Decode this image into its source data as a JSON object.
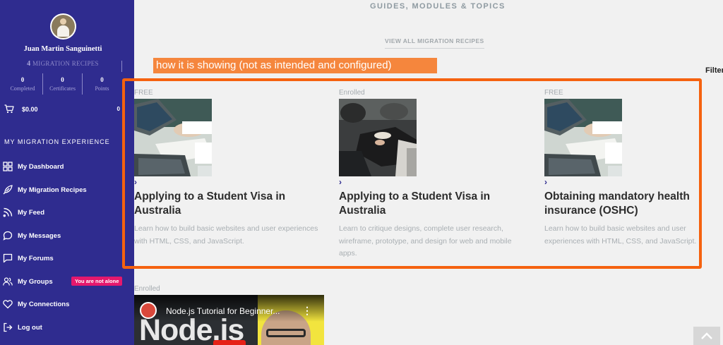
{
  "sidebar": {
    "user_name": "Juan Martin Sanguinetti",
    "recipes_count": "4",
    "recipes_label": "MIGRATION RECIPES",
    "stats": [
      {
        "value": "0",
        "label": "Completed"
      },
      {
        "value": "0",
        "label": "Certificates"
      },
      {
        "value": "0",
        "label": "Points"
      }
    ],
    "cart_amount": "$0.00",
    "cart_count": "0",
    "section_heading": "MY MIGRATION EXPERIENCE",
    "nav": [
      {
        "label": "My Dashboard",
        "icon": "grid-icon"
      },
      {
        "label": "My Migration Recipes",
        "icon": "rocket-icon"
      },
      {
        "label": "My Feed",
        "icon": "rss-icon"
      },
      {
        "label": "My Messages",
        "icon": "chat-bubble-icon"
      },
      {
        "label": "My Forums",
        "icon": "forum-icon"
      },
      {
        "label": "My Groups",
        "icon": "users-icon",
        "badge": "You are not alone"
      },
      {
        "label": "My Connections",
        "icon": "heart-icon"
      },
      {
        "label": "Log out",
        "icon": "logout-icon"
      }
    ]
  },
  "main": {
    "section_title": "GUIDES, MODULES & TOPICS",
    "view_all_link": "VIEW ALL MIGRATION RECIPES",
    "annotation_label": "how it is showing (not as intended and configured)",
    "filter_label": "Filter",
    "cards": [
      {
        "tag": "FREE",
        "title": "Applying to a Student Visa in Australia",
        "description": "Learn how to build basic websites and user experiences with HTML, CSS, and JavaScript."
      },
      {
        "tag": "Enrolled",
        "title": "Applying to a Student Visa in Australia",
        "description": "Learn to critique designs, complete user research, wireframe, prototype, and design for web and mobile apps."
      },
      {
        "tag": "FREE",
        "title": "Obtaining mandatory health insurance (OSHC)",
        "description": "Learn how to build basic websites and user experiences with HTML, CSS, and JavaScript."
      }
    ],
    "next_tag": "Enrolled",
    "video": {
      "title": "Node.js Tutorial for Beginner...",
      "overlay_text": "Node.js"
    }
  },
  "colors": {
    "sidebar_bg": "#2f2c8f",
    "annotation": "#f5620f",
    "badge": "#e5186d"
  }
}
